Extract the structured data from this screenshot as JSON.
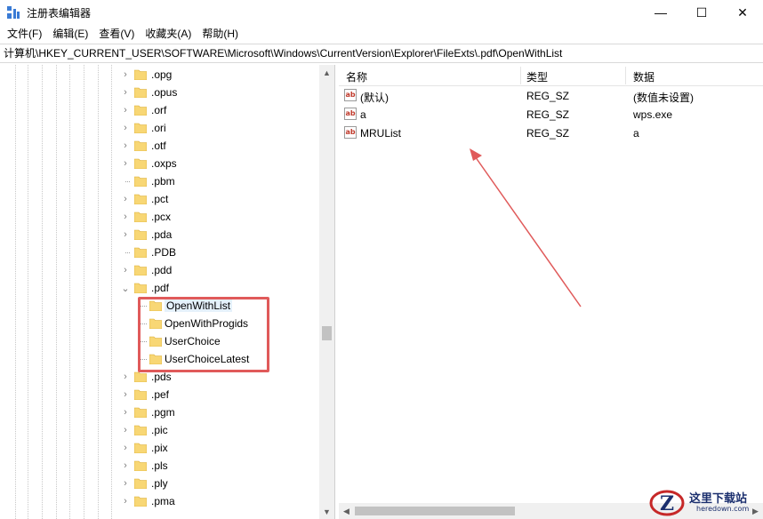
{
  "window": {
    "title": "注册表编辑器",
    "controls": {
      "minimize": "—",
      "maximize": "☐",
      "close": "✕"
    }
  },
  "menu": [
    "文件(F)",
    "编辑(E)",
    "查看(V)",
    "收藏夹(A)",
    "帮助(H)"
  ],
  "address": "计算机\\HKEY_CURRENT_USER\\SOFTWARE\\Microsoft\\Windows\\CurrentVersion\\Explorer\\FileExts\\.pdf\\OpenWithList",
  "tree": {
    "items": [
      {
        "label": ".opg",
        "expander": "collapsed"
      },
      {
        "label": ".opus",
        "expander": "collapsed"
      },
      {
        "label": ".orf",
        "expander": "collapsed"
      },
      {
        "label": ".ori",
        "expander": "collapsed"
      },
      {
        "label": ".otf",
        "expander": "collapsed"
      },
      {
        "label": ".oxps",
        "expander": "collapsed"
      },
      {
        "label": ".pbm",
        "expander": "none"
      },
      {
        "label": ".pct",
        "expander": "collapsed"
      },
      {
        "label": ".pcx",
        "expander": "collapsed"
      },
      {
        "label": ".pda",
        "expander": "collapsed"
      },
      {
        "label": ".PDB",
        "expander": "none"
      },
      {
        "label": ".pdd",
        "expander": "collapsed"
      },
      {
        "label": ".pdf",
        "expander": "expanded"
      },
      {
        "label": "OpenWithList",
        "expander": "child",
        "selected": true
      },
      {
        "label": "OpenWithProgids",
        "expander": "child"
      },
      {
        "label": "UserChoice",
        "expander": "child"
      },
      {
        "label": "UserChoiceLatest",
        "expander": "child"
      },
      {
        "label": ".pds",
        "expander": "collapsed"
      },
      {
        "label": ".pef",
        "expander": "collapsed"
      },
      {
        "label": ".pgm",
        "expander": "collapsed"
      },
      {
        "label": ".pic",
        "expander": "collapsed"
      },
      {
        "label": ".pix",
        "expander": "collapsed"
      },
      {
        "label": ".pls",
        "expander": "collapsed"
      },
      {
        "label": ".ply",
        "expander": "collapsed"
      },
      {
        "label": ".pma",
        "expander": "collapsed"
      }
    ]
  },
  "values": {
    "columns": {
      "name": "名称",
      "type": "类型",
      "data": "数据"
    },
    "rows": [
      {
        "name": "(默认)",
        "type": "REG_SZ",
        "data": "(数值未设置)"
      },
      {
        "name": "a",
        "type": "REG_SZ",
        "data": "wps.exe"
      },
      {
        "name": "MRUList",
        "type": "REG_SZ",
        "data": "a"
      }
    ]
  },
  "watermark": {
    "text": "这里下载站",
    "sub": "heredown.com",
    "letter": "Z"
  },
  "colors": {
    "highlight": "#e05a5a",
    "selection": "#e5f1fb",
    "folder": "#f8d775",
    "watermark": "#1b2f6e"
  },
  "icons": {
    "value_type": "ab",
    "chevron_right": "›",
    "chevron_down": "⌄"
  }
}
